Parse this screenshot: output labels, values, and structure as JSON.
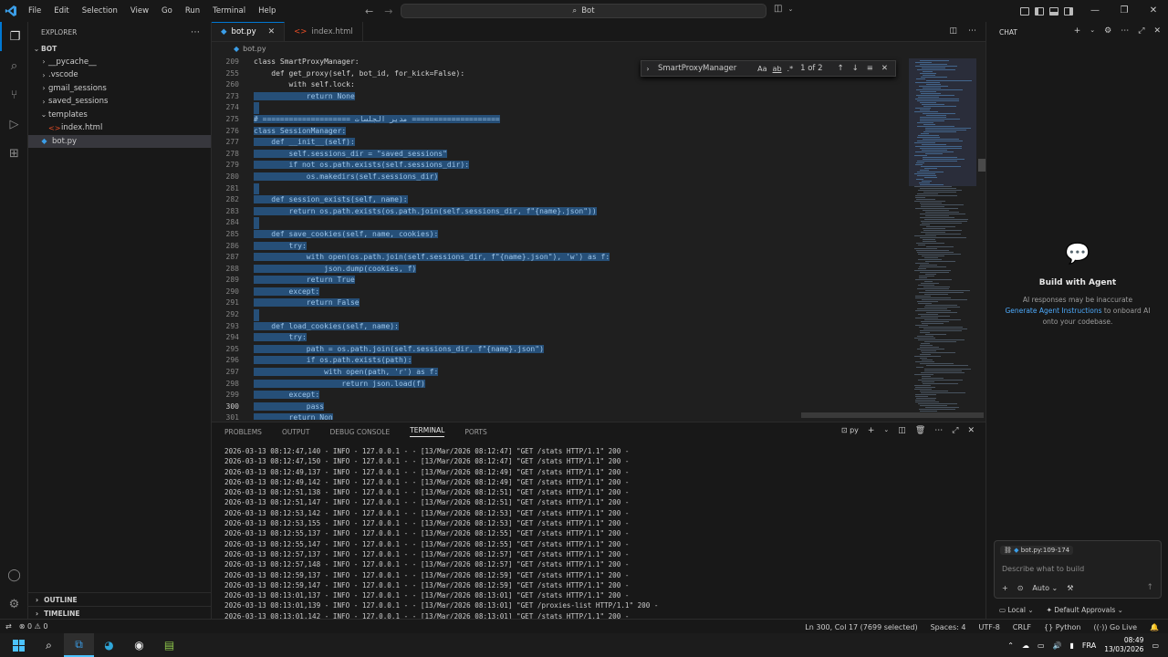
{
  "window": {
    "menu": [
      "File",
      "Edit",
      "Selection",
      "View",
      "Go",
      "Run",
      "Terminal",
      "Help"
    ],
    "search_text": "Bot"
  },
  "explorer": {
    "title": "EXPLORER",
    "root": "BOT",
    "items": [
      {
        "label": "__pycache__",
        "type": "folder",
        "level": 1
      },
      {
        "label": ".vscode",
        "type": "folder",
        "level": 1
      },
      {
        "label": "gmail_sessions",
        "type": "folder",
        "level": 1
      },
      {
        "label": "saved_sessions",
        "type": "folder",
        "level": 1
      },
      {
        "label": "templates",
        "type": "folder-open",
        "level": 1
      },
      {
        "label": "index.html",
        "type": "html",
        "level": 2
      },
      {
        "label": "bot.py",
        "type": "py",
        "level": 1
      }
    ],
    "outline": "OUTLINE",
    "timeline": "TIMELINE"
  },
  "tabs": [
    {
      "label": "bot.py",
      "active": true
    },
    {
      "label": "index.html",
      "active": false
    }
  ],
  "breadcrumb": "bot.py",
  "find": {
    "query": "SmartProxyManager",
    "count": "1 of 2"
  },
  "code": [
    {
      "n": "209",
      "t": "class SmartProxyManager:",
      "sel": false
    },
    {
      "n": "255",
      "t": "    def get_proxy(self, bot_id, for_kick=False):",
      "sel": false
    },
    {
      "n": "260",
      "t": "        with self.lock:",
      "sel": false
    },
    {
      "n": "273",
      "t": "            return None",
      "sel": true
    },
    {
      "n": "274",
      "t": "",
      "sel": true
    },
    {
      "n": "275",
      "t": "# ==================== مدير الجلسات ====================",
      "sel": true
    },
    {
      "n": "276",
      "t": "class SessionManager:",
      "sel": true
    },
    {
      "n": "277",
      "t": "    def __init__(self):",
      "sel": true
    },
    {
      "n": "278",
      "t": "        self.sessions_dir = \"saved_sessions\"",
      "sel": true
    },
    {
      "n": "279",
      "t": "        if not os.path.exists(self.sessions_dir):",
      "sel": true
    },
    {
      "n": "280",
      "t": "            os.makedirs(self.sessions_dir)",
      "sel": true
    },
    {
      "n": "281",
      "t": "",
      "sel": true
    },
    {
      "n": "282",
      "t": "    def session_exists(self, name):",
      "sel": true
    },
    {
      "n": "283",
      "t": "        return os.path.exists(os.path.join(self.sessions_dir, f\"{name}.json\"))",
      "sel": true
    },
    {
      "n": "284",
      "t": "",
      "sel": true
    },
    {
      "n": "285",
      "t": "    def save_cookies(self, name, cookies):",
      "sel": true
    },
    {
      "n": "286",
      "t": "        try:",
      "sel": true
    },
    {
      "n": "287",
      "t": "            with open(os.path.join(self.sessions_dir, f\"{name}.json\"), 'w') as f:",
      "sel": true
    },
    {
      "n": "288",
      "t": "                json.dump(cookies, f)",
      "sel": true
    },
    {
      "n": "289",
      "t": "            return True",
      "sel": true
    },
    {
      "n": "290",
      "t": "        except:",
      "sel": true
    },
    {
      "n": "291",
      "t": "            return False",
      "sel": true
    },
    {
      "n": "292",
      "t": "",
      "sel": true
    },
    {
      "n": "293",
      "t": "    def load_cookies(self, name):",
      "sel": true
    },
    {
      "n": "294",
      "t": "        try:",
      "sel": true
    },
    {
      "n": "295",
      "t": "            path = os.path.join(self.sessions_dir, f\"{name}.json\")",
      "sel": true
    },
    {
      "n": "296",
      "t": "            if os.path.exists(path):",
      "sel": true
    },
    {
      "n": "297",
      "t": "                with open(path, 'r') as f:",
      "sel": true
    },
    {
      "n": "298",
      "t": "                    return json.load(f)",
      "sel": true
    },
    {
      "n": "299",
      "t": "        except:",
      "sel": true
    },
    {
      "n": "300",
      "t": "            pass",
      "sel": true
    },
    {
      "n": "301",
      "t": "        return Non",
      "sel": true
    }
  ],
  "panel": {
    "tabs": [
      "PROBLEMS",
      "OUTPUT",
      "DEBUG CONSOLE",
      "TERMINAL",
      "PORTS"
    ],
    "active": "TERMINAL",
    "shell": "py",
    "lines": [
      "2026-03-13 08:12:47,140 - INFO - 127.0.0.1 - - [13/Mar/2026 08:12:47] \"GET /stats HTTP/1.1\" 200 -",
      "2026-03-13 08:12:47,150 - INFO - 127.0.0.1 - - [13/Mar/2026 08:12:47] \"GET /stats HTTP/1.1\" 200 -",
      "2026-03-13 08:12:49,137 - INFO - 127.0.0.1 - - [13/Mar/2026 08:12:49] \"GET /stats HTTP/1.1\" 200 -",
      "2026-03-13 08:12:49,142 - INFO - 127.0.0.1 - - [13/Mar/2026 08:12:49] \"GET /stats HTTP/1.1\" 200 -",
      "2026-03-13 08:12:51,138 - INFO - 127.0.0.1 - - [13/Mar/2026 08:12:51] \"GET /stats HTTP/1.1\" 200 -",
      "2026-03-13 08:12:51,147 - INFO - 127.0.0.1 - - [13/Mar/2026 08:12:51] \"GET /stats HTTP/1.1\" 200 -",
      "2026-03-13 08:12:53,142 - INFO - 127.0.0.1 - - [13/Mar/2026 08:12:53] \"GET /stats HTTP/1.1\" 200 -",
      "2026-03-13 08:12:53,155 - INFO - 127.0.0.1 - - [13/Mar/2026 08:12:53] \"GET /stats HTTP/1.1\" 200 -",
      "2026-03-13 08:12:55,137 - INFO - 127.0.0.1 - - [13/Mar/2026 08:12:55] \"GET /stats HTTP/1.1\" 200 -",
      "2026-03-13 08:12:55,147 - INFO - 127.0.0.1 - - [13/Mar/2026 08:12:55] \"GET /stats HTTP/1.1\" 200 -",
      "2026-03-13 08:12:57,137 - INFO - 127.0.0.1 - - [13/Mar/2026 08:12:57] \"GET /stats HTTP/1.1\" 200 -",
      "2026-03-13 08:12:57,148 - INFO - 127.0.0.1 - - [13/Mar/2026 08:12:57] \"GET /stats HTTP/1.1\" 200 -",
      "2026-03-13 08:12:59,137 - INFO - 127.0.0.1 - - [13/Mar/2026 08:12:59] \"GET /stats HTTP/1.1\" 200 -",
      "2026-03-13 08:12:59,147 - INFO - 127.0.0.1 - - [13/Mar/2026 08:12:59] \"GET /stats HTTP/1.1\" 200 -",
      "2026-03-13 08:13:01,137 - INFO - 127.0.0.1 - - [13/Mar/2026 08:13:01] \"GET /stats HTTP/1.1\" 200 -",
      "2026-03-13 08:13:01,139 - INFO - 127.0.0.1 - - [13/Mar/2026 08:13:01] \"GET /proxies-list HTTP/1.1\" 200 -",
      "2026-03-13 08:13:01,142 - INFO - 127.0.0.1 - - [13/Mar/2026 08:13:01] \"GET /stats HTTP/1.1\" 200 -"
    ]
  },
  "chat": {
    "title": "CHAT",
    "agent_title": "Build with Agent",
    "agent_line1": "AI responses may be inaccurate",
    "agent_link": "Generate Agent Instructions",
    "agent_line2": " to onboard AI",
    "agent_line3": "onto your codebase.",
    "context_chip": "bot.py:109-174",
    "placeholder": "Describe what to build",
    "mode": "Auto",
    "local": "Local",
    "approvals": "Default Approvals"
  },
  "status": {
    "problems": "0",
    "warnings": "0",
    "position": "Ln 300, Col 17 (7699 selected)",
    "spaces": "Spaces: 4",
    "encoding": "UTF-8",
    "eol": "CRLF",
    "language": "Python",
    "golive": "Go Live"
  },
  "taskbar": {
    "lang": "FRA",
    "time": "08:49",
    "date": "13/03/2026"
  },
  "colors": {
    "accent": "#0078d4",
    "selection": "#264f78"
  }
}
